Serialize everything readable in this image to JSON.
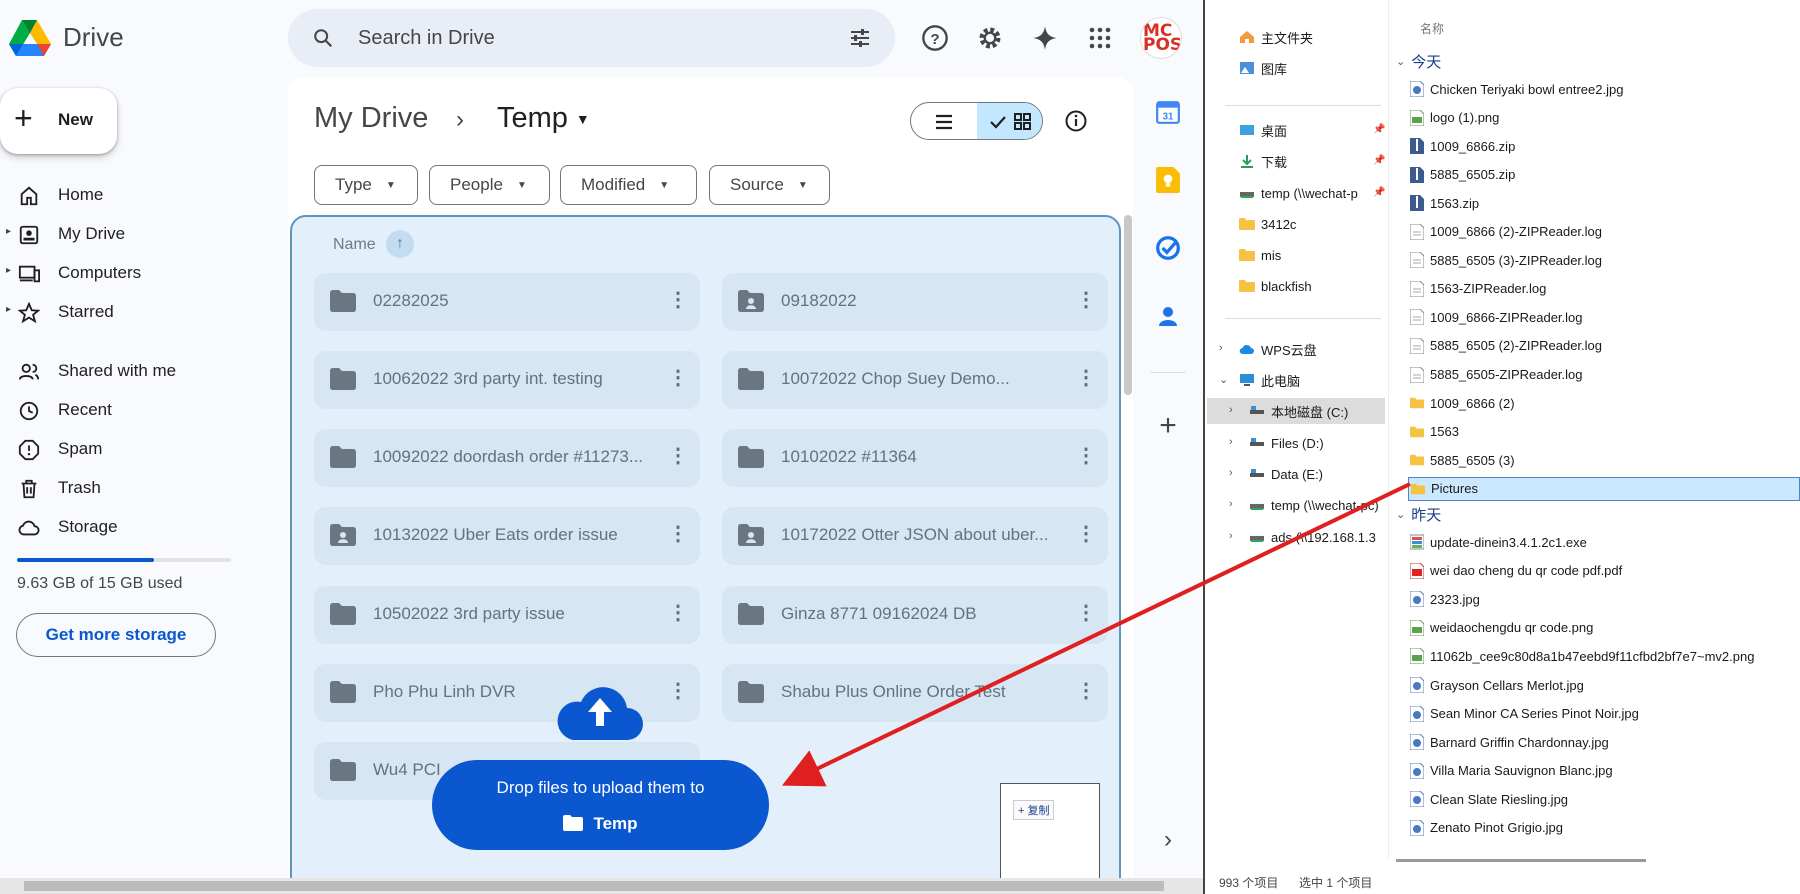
{
  "drive": {
    "brand": "Drive",
    "search_placeholder": "Search in Drive",
    "new_label": "New",
    "nav": [
      {
        "label": "Home",
        "icon": "home-icon"
      },
      {
        "label": "My Drive",
        "icon": "my-drive-icon"
      },
      {
        "label": "Computers",
        "icon": "computers-icon"
      },
      {
        "label": "Starred",
        "icon": "star-icon"
      },
      {
        "label": "Shared with me",
        "icon": "shared-icon"
      },
      {
        "label": "Recent",
        "icon": "clock-icon"
      },
      {
        "label": "Spam",
        "icon": "spam-icon"
      },
      {
        "label": "Trash",
        "icon": "trash-icon"
      },
      {
        "label": "Storage",
        "icon": "cloud-icon"
      }
    ],
    "storage": {
      "text": "9.63 GB of 15 GB used",
      "used_fraction": 0.642,
      "button": "Get more storage"
    },
    "avatar_text": "MC POS",
    "breadcrumb": {
      "root": "My Drive",
      "sep": "›",
      "current": "Temp"
    },
    "filters": [
      "Type",
      "People",
      "Modified",
      "Source"
    ],
    "name_header": "Name",
    "folders": [
      {
        "name": "02282025",
        "shared": false
      },
      {
        "name": "09182022",
        "shared": true
      },
      {
        "name": "10062022 3rd party int. testing",
        "shared": false
      },
      {
        "name": "10072022 Chop Suey Demo...",
        "shared": false
      },
      {
        "name": "10092022 doordash order #11273...",
        "shared": false
      },
      {
        "name": "10102022 #11364",
        "shared": false
      },
      {
        "name": "10132022 Uber Eats order issue",
        "shared": true
      },
      {
        "name": "10172022 Otter JSON about uber...",
        "shared": true
      },
      {
        "name": "10502022 3rd party issue",
        "shared": false
      },
      {
        "name": "Ginza 8771 09162024 DB",
        "shared": false
      },
      {
        "name": "Pho Phu Linh DVR",
        "shared": false
      },
      {
        "name": "Shabu Plus Online Order Test",
        "shared": false
      },
      {
        "name": "Wu4 PCI",
        "shared": false
      }
    ],
    "drop": {
      "line1": "Drop files to upload them to",
      "target": "Temp"
    },
    "copy_label": "+ 复制",
    "accent": "#0b57d0",
    "drop_bg": "#e3f0fb"
  },
  "explorer": {
    "col_header": "名称",
    "nav": [
      {
        "label": "主文件夹",
        "icon": "home-icon",
        "pinned": false
      },
      {
        "label": "图库",
        "icon": "gallery-icon",
        "pinned": false
      },
      {
        "label": "桌面",
        "icon": "desktop-icon",
        "pinned": true
      },
      {
        "label": "下载",
        "icon": "download-icon",
        "pinned": true
      },
      {
        "label": "temp (\\\\wechat-p",
        "icon": "network-drive-icon",
        "pinned": true
      },
      {
        "label": "3412c",
        "icon": "folder-icon",
        "pinned": false
      },
      {
        "label": "mis",
        "icon": "folder-icon",
        "pinned": false
      },
      {
        "label": "blackfish",
        "icon": "folder-icon",
        "pinned": false
      },
      {
        "label": "WPS云盘",
        "icon": "cloud-icon",
        "pinned": false
      },
      {
        "label": "此电脑",
        "icon": "pc-icon",
        "pinned": false
      },
      {
        "label": "本地磁盘 (C:)",
        "icon": "disk-icon",
        "pinned": false
      },
      {
        "label": "Files (D:)",
        "icon": "disk-icon",
        "pinned": false
      },
      {
        "label": "Data (E:)",
        "icon": "disk-icon",
        "pinned": false
      },
      {
        "label": "temp (\\\\wechat-pc)",
        "icon": "network-drive-icon",
        "pinned": false
      },
      {
        "label": "ads (\\\\192.168.1.3",
        "icon": "network-drive-icon",
        "pinned": false
      }
    ],
    "groups": [
      {
        "label": "今天",
        "files": [
          {
            "name": "Chicken Teriyaki bowl entree2.jpg",
            "type": "img"
          },
          {
            "name": "logo (1).png",
            "type": "png"
          },
          {
            "name": "1009_6866.zip",
            "type": "zip"
          },
          {
            "name": "5885_6505.zip",
            "type": "zip"
          },
          {
            "name": "1563.zip",
            "type": "zip"
          },
          {
            "name": "1009_6866 (2)-ZIPReader.log",
            "type": "log"
          },
          {
            "name": "5885_6505 (3)-ZIPReader.log",
            "type": "log"
          },
          {
            "name": "1563-ZIPReader.log",
            "type": "log"
          },
          {
            "name": "1009_6866-ZIPReader.log",
            "type": "log"
          },
          {
            "name": "5885_6505 (2)-ZIPReader.log",
            "type": "log"
          },
          {
            "name": "5885_6505-ZIPReader.log",
            "type": "log"
          },
          {
            "name": "1009_6866 (2)",
            "type": "folder"
          },
          {
            "name": "1563",
            "type": "folder"
          },
          {
            "name": "5885_6505 (3)",
            "type": "folder"
          },
          {
            "name": "Pictures",
            "type": "folder",
            "selected": true
          }
        ]
      },
      {
        "label": "昨天",
        "files": [
          {
            "name": "update-dinein3.4.1.2c1.exe",
            "type": "exe"
          },
          {
            "name": "wei dao cheng du qr code pdf.pdf",
            "type": "pdf"
          },
          {
            "name": "2323.jpg",
            "type": "img"
          },
          {
            "name": "weidaochengdu qr code.png",
            "type": "png"
          },
          {
            "name": "11062b_cee9c80d8a1b47eebd9f11cfbd2bf7e7~mv2.png",
            "type": "png"
          },
          {
            "name": "Grayson Cellars Merlot.jpg",
            "type": "img"
          },
          {
            "name": "Sean Minor CA Series Pinot Noir.jpg",
            "type": "img"
          },
          {
            "name": "Barnard Griffin Chardonnay.jpg",
            "type": "img"
          },
          {
            "name": "Villa Maria Sauvignon Blanc.jpg",
            "type": "img"
          },
          {
            "name": "Clean Slate Riesling.jpg",
            "type": "img"
          },
          {
            "name": "Zenato Pinot Grigio.jpg",
            "type": "img"
          }
        ]
      }
    ],
    "status_count": "993 个项目",
    "status_selected": "选中 1 个项目"
  }
}
